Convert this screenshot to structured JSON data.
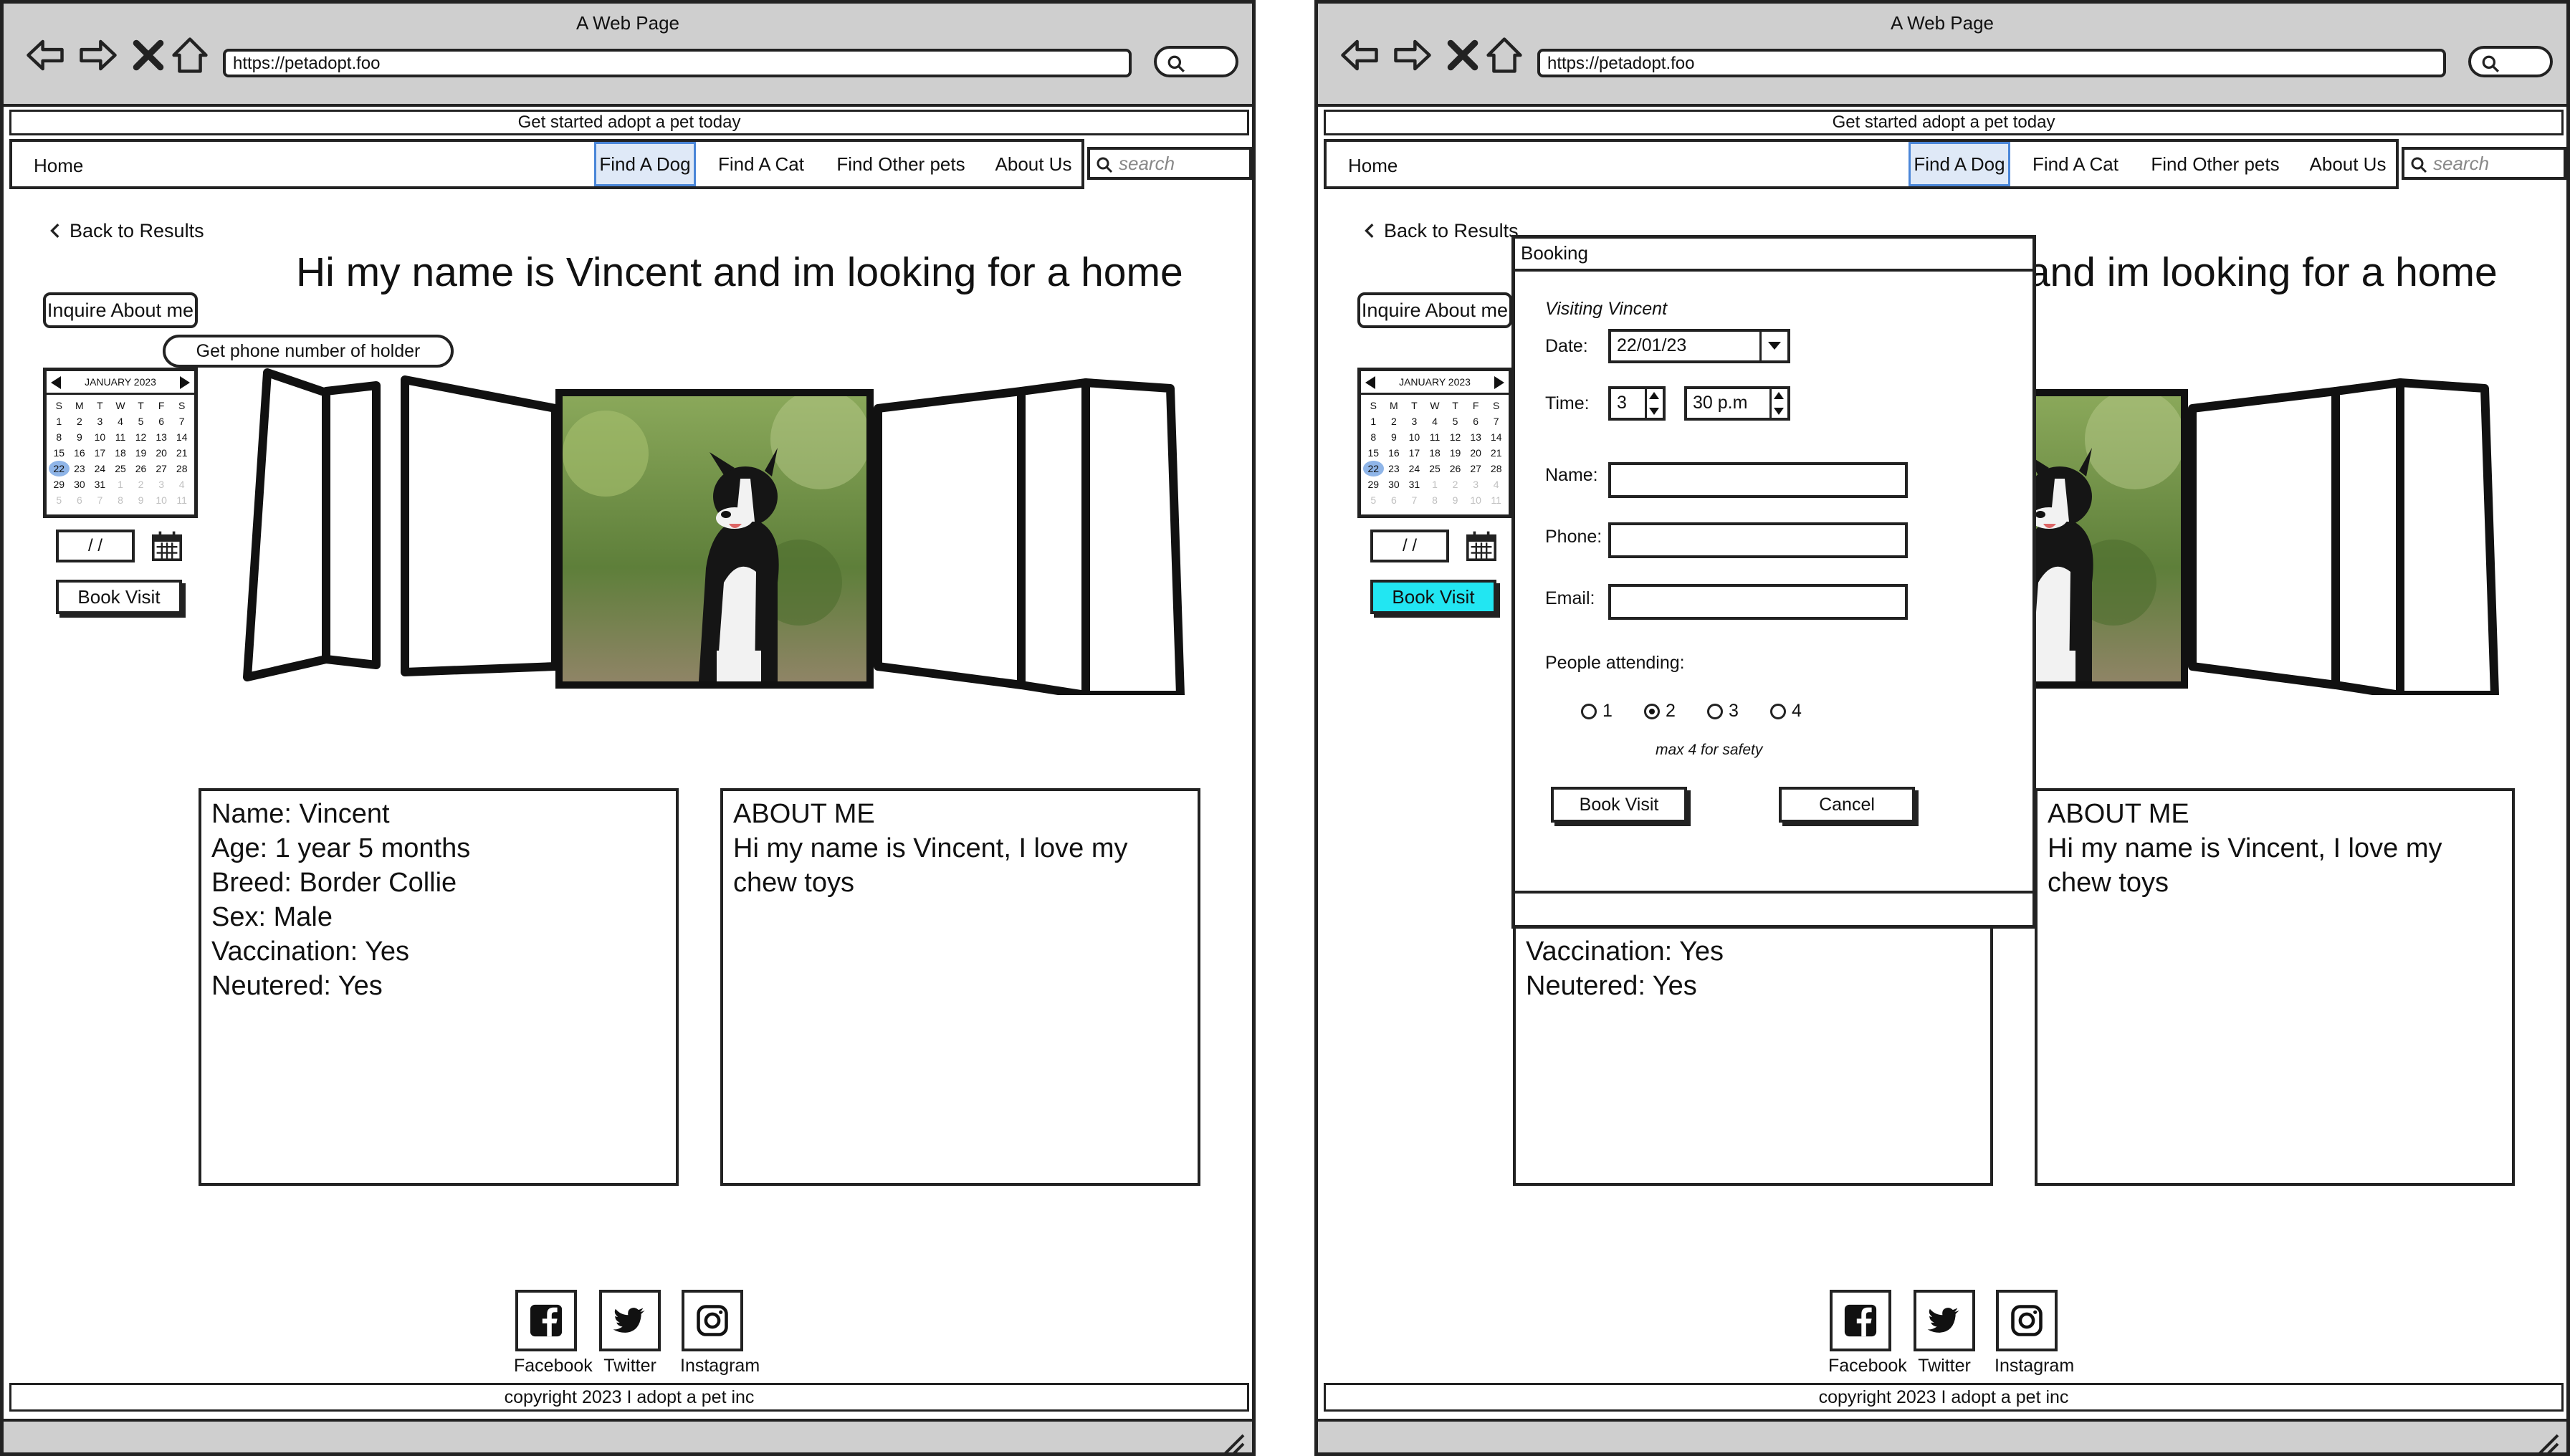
{
  "window": {
    "title": "A Web Page",
    "url": "https://petadopt.foo"
  },
  "banner": "Get started adopt a pet today",
  "nav": {
    "home": "Home",
    "items": [
      "Find A Dog",
      "Find A Cat",
      "Find Other pets",
      "About Us"
    ],
    "active": "Find A Dog",
    "search_placeholder": "search"
  },
  "page": {
    "back": "Back to Results",
    "heading": "Hi my name is Vincent and im looking for a home",
    "inquire": "Inquire About me",
    "tooltip": "Get phone number of holder",
    "date_placeholder": "/ /",
    "book_visit": "Book Visit"
  },
  "calendar": {
    "month": "JANUARY 2023",
    "weekdays": [
      "S",
      "M",
      "T",
      "W",
      "T",
      "F",
      "S"
    ],
    "days": [
      "1",
      "2",
      "3",
      "4",
      "5",
      "6",
      "7",
      "8",
      "9",
      "10",
      "11",
      "12",
      "13",
      "14",
      "15",
      "16",
      "17",
      "18",
      "19",
      "20",
      "21",
      "22",
      "23",
      "24",
      "25",
      "26",
      "27",
      "28",
      "29",
      "30",
      "31",
      "1",
      "2",
      "3",
      "4",
      "5",
      "6",
      "7",
      "8",
      "9",
      "10",
      "11"
    ],
    "selected": "22"
  },
  "info": {
    "lines": [
      "Name: Vincent",
      "Age: 1 year 5 months",
      "Breed: Border Collie",
      "Sex: Male",
      "Vaccination: Yes",
      "Neutered: Yes"
    ]
  },
  "about": {
    "title": "ABOUT ME",
    "text": "Hi my name is Vincent, I love my chew toys"
  },
  "social": [
    "Facebook",
    "Twitter",
    "Instagram"
  ],
  "footer": "copyright 2023 I adopt a pet inc",
  "booking": {
    "title": "Booking",
    "visiting": "Visiting Vincent",
    "date_label": "Date:",
    "date_value": "22/01/23",
    "time_label": "Time:",
    "hour": "3",
    "minute": "30 p.m",
    "name_label": "Name:",
    "phone_label": "Phone:",
    "email_label": "Email:",
    "people_label": "People attending:",
    "options": [
      "1",
      "2",
      "3",
      "4"
    ],
    "selected_option": "2",
    "note": "max 4 for safety",
    "book": "Book Visit",
    "cancel": "Cancel"
  },
  "colors": {
    "chrome": "#cfcfcf",
    "active_nav": "#dfe9f7",
    "active_border": "#4a86d8",
    "book_highlight": "#22e6f2",
    "calendar_select": "#8fb5e8"
  }
}
